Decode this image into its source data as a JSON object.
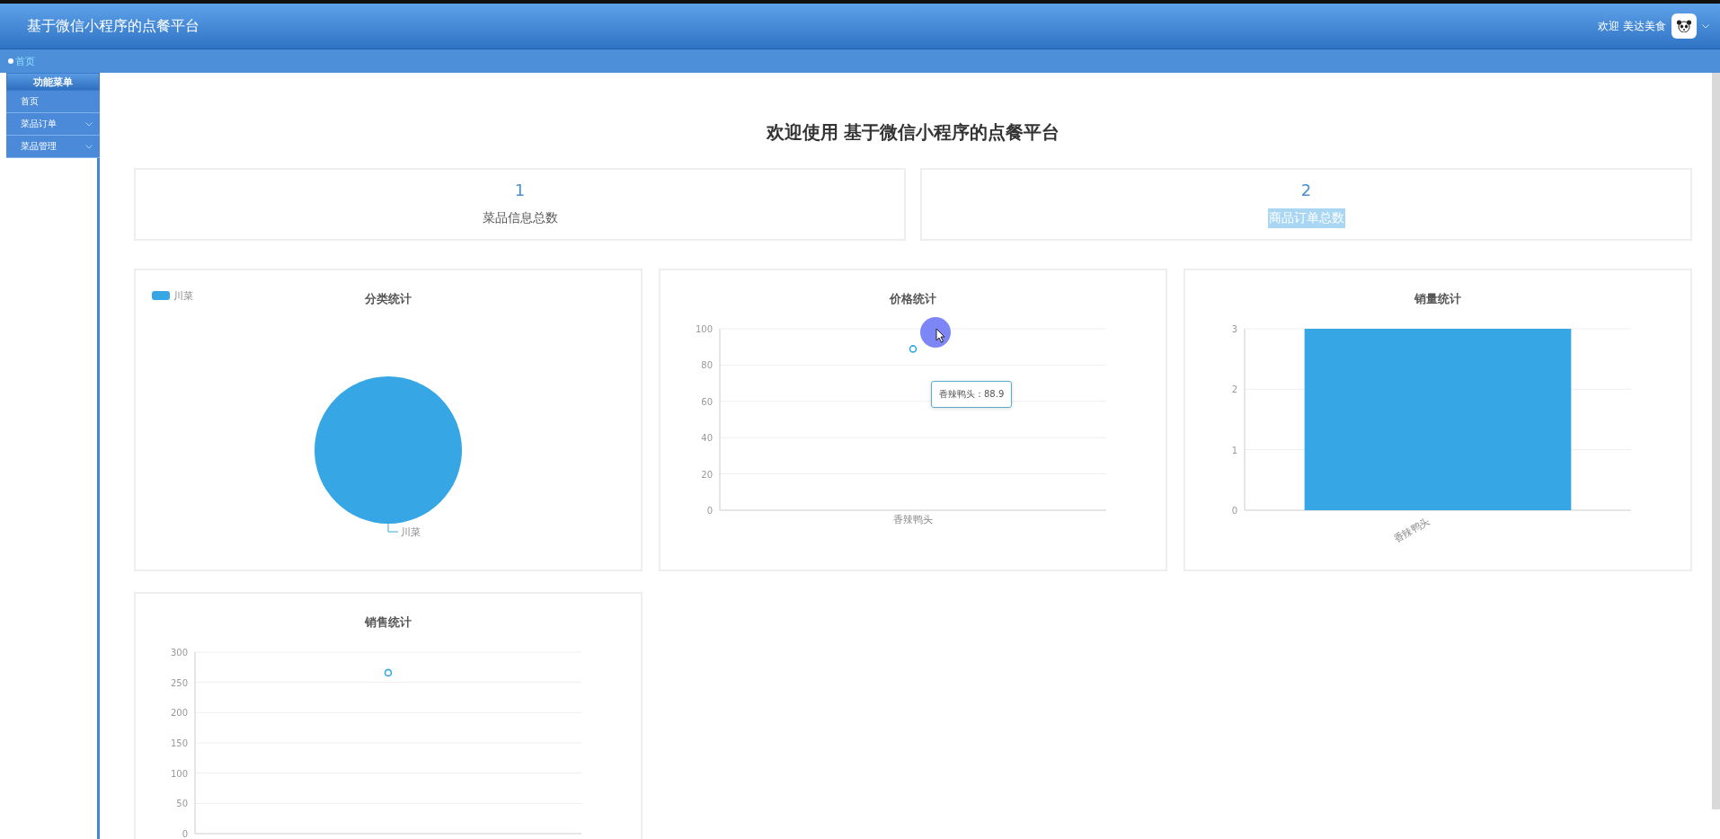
{
  "header": {
    "title": "基于微信小程序的点餐平台",
    "greeting": "欢迎 美达美食"
  },
  "breadcrumb": [
    {
      "label": "首页"
    }
  ],
  "sidebar": {
    "heading": "功能菜单",
    "items": [
      {
        "label": "首页",
        "expandable": false
      },
      {
        "label": "菜品订单",
        "expandable": true
      },
      {
        "label": "菜品管理",
        "expandable": true
      }
    ]
  },
  "welcome": "欢迎使用 基于微信小程序的点餐平台",
  "stats": [
    {
      "value": "1",
      "label": "菜品信息总数",
      "highlighted": false
    },
    {
      "value": "2",
      "label": "商品订单总数",
      "highlighted": true
    }
  ],
  "charts": [
    {
      "chart_data": {
        "type": "pie",
        "title": "分类统计",
        "categories": [
          "川菜"
        ],
        "series": [
          {
            "color": "#36a6e4",
            "values": [
              1
            ]
          }
        ]
      }
    },
    {
      "chart_data": {
        "type": "line",
        "title": "价格统计",
        "categories": [
          "香辣鸭头"
        ],
        "series": [
          {
            "color": "#36a6e4",
            "values": [
              88.9
            ],
            "marker": true
          }
        ],
        "grid": true,
        "ylim": [
          0,
          100
        ],
        "yticks": [
          0,
          20,
          40,
          60,
          80,
          100
        ]
      },
      "tooltip": "香辣鸭头：88.9"
    },
    {
      "chart_data": {
        "type": "bar",
        "title": "销量统计",
        "categories": [
          "香辣鸭头"
        ],
        "series": [
          {
            "color": "#36a6e4",
            "values": [
              3
            ]
          }
        ],
        "grid": true,
        "ylim": [
          0,
          3
        ],
        "yticks": [
          0,
          1,
          2,
          3
        ]
      }
    },
    {
      "chart_data": {
        "type": "line",
        "title": "销售统计",
        "series": [
          {
            "color": "#36a6e4",
            "values": [
              266
            ],
            "marker": true
          }
        ],
        "grid": true,
        "ylim": [
          0,
          300
        ],
        "yticks": [
          0,
          50,
          100,
          150,
          200,
          250,
          300
        ]
      }
    }
  ]
}
